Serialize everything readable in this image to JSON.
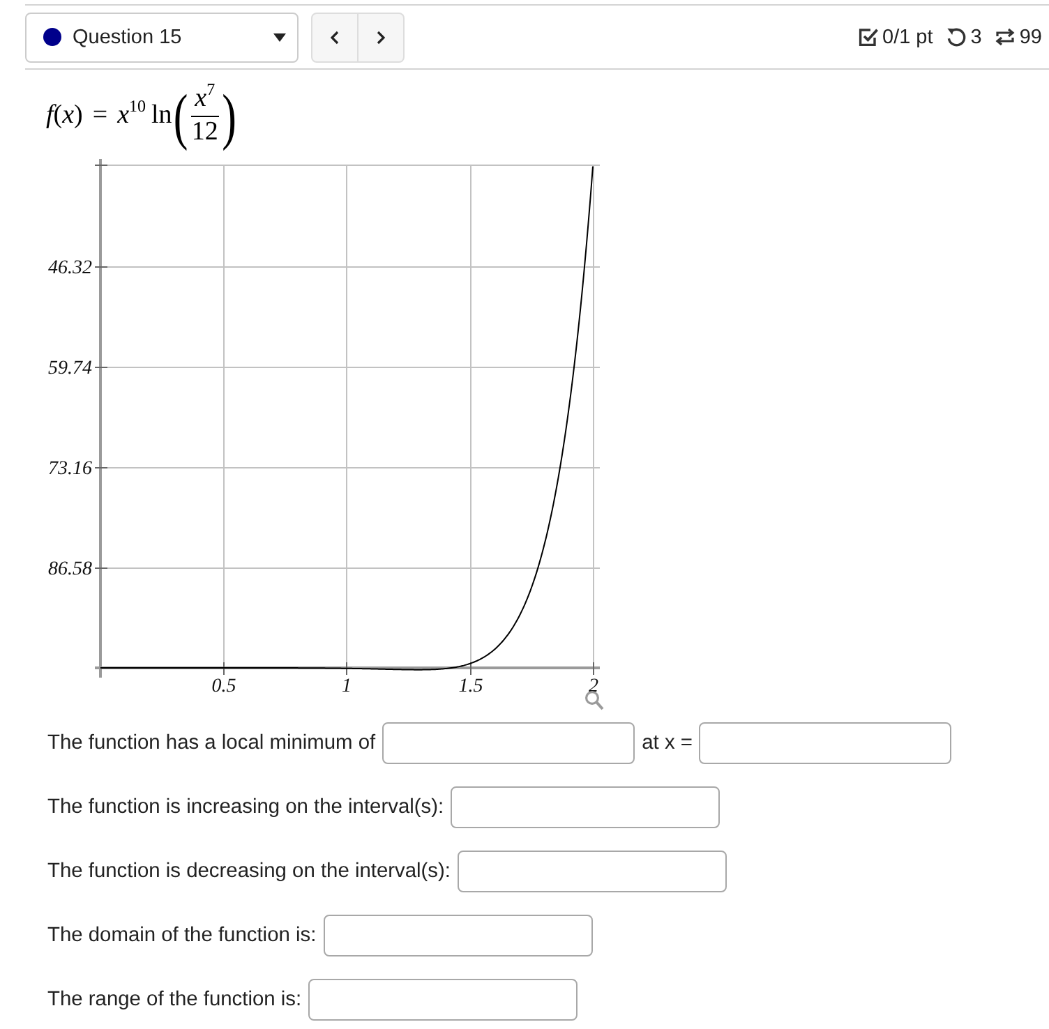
{
  "header": {
    "question_select": {
      "label": "Question 15"
    },
    "score": "0/1 pt",
    "retries": "3",
    "attempts": "99"
  },
  "formula": {
    "lhs": "*f*(*x*)",
    "relation": "=",
    "term": "*x*$^{10}$",
    "function": "ln",
    "open": "(",
    "numerator": "*x*$^{7}$",
    "denominator": "12",
    "close": ")"
  },
  "graph": {
    "y_tick_labels": [
      "46.32",
      "59.74",
      "73.16",
      "86.58"
    ],
    "x_tick_labels": [
      "0.5",
      "1",
      "1.5",
      "2"
    ]
  },
  "questions": [
    {
      "parts": [
        {
          "kind": "text",
          "text": "The function has a local minimum of"
        },
        {
          "kind": "field"
        },
        {
          "kind": "text",
          "text": "at x ="
        },
        {
          "kind": "field"
        }
      ]
    },
    {
      "parts": [
        {
          "kind": "text",
          "text": "The function is increasing on the interval(s):"
        },
        {
          "kind": "field"
        }
      ]
    },
    {
      "parts": [
        {
          "kind": "text",
          "text": "The function is decreasing on the interval(s):"
        },
        {
          "kind": "field"
        }
      ]
    },
    {
      "parts": [
        {
          "kind": "text",
          "text": "The domain of the function is:"
        },
        {
          "kind": "field"
        }
      ]
    },
    {
      "parts": [
        {
          "kind": "text",
          "text": "The range of the function is:"
        },
        {
          "kind": "field"
        }
      ]
    }
  ]
}
